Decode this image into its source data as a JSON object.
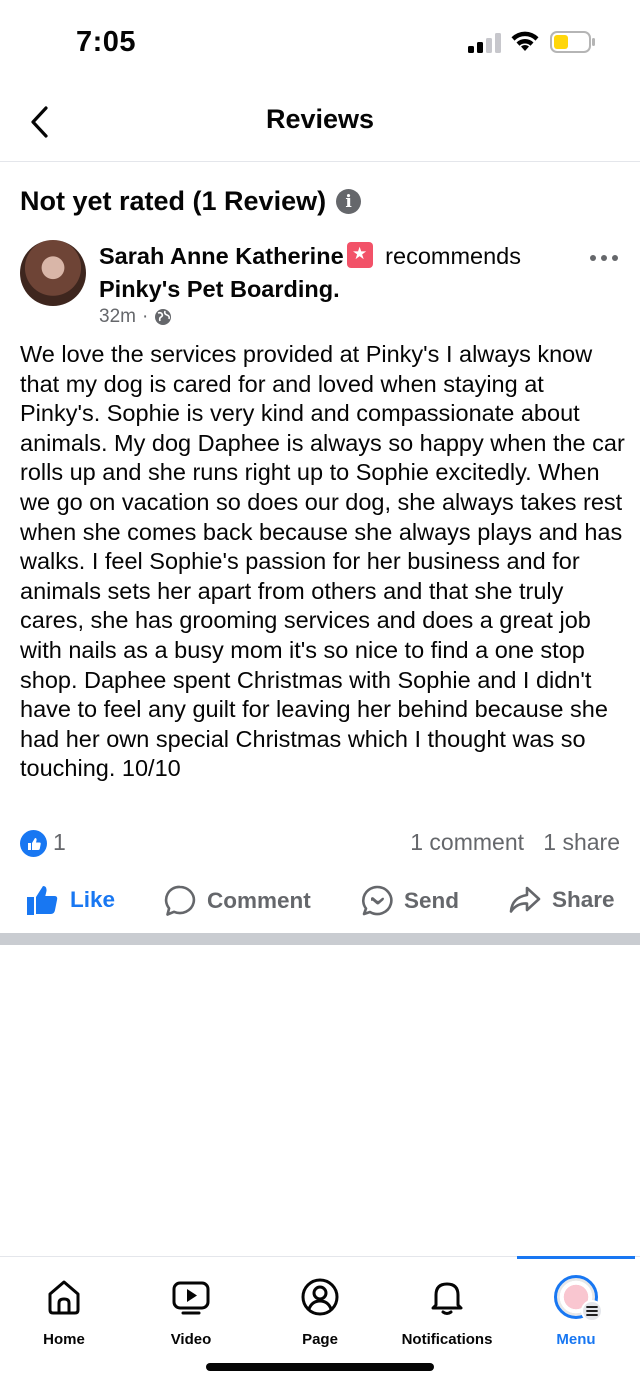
{
  "status_bar": {
    "time": "7:05"
  },
  "header": {
    "title": "Reviews"
  },
  "rating": {
    "heading": "Not yet rated (1 Review)"
  },
  "post": {
    "author": "Sarah Anne Katherine",
    "verb": "recommends",
    "page": "Pinky's Pet Boarding.",
    "time": "32m",
    "body": "We love the services provided at Pinky's I always know that my dog is cared for and loved when staying at Pinky's. Sophie is very kind and compassionate about animals. My dog Daphee is always so happy when the car rolls up and she runs right up to Sophie excitedly. When we go on vacation so does our dog, she always takes rest when she comes back because she always plays and has walks. I feel Sophie's passion for her business and for animals sets her apart from others and that she truly cares, she has grooming services and does a great job with nails as a busy mom it's so nice to find a one stop shop. Daphee spent Christmas with Sophie and I didn't have to feel any guilt for leaving her behind because she had her own special Christmas which I thought was so touching. 10/10",
    "reactions": "1",
    "comments": "1 comment",
    "shares": "1 share"
  },
  "actions": {
    "like": "Like",
    "comment": "Comment",
    "send": "Send",
    "share": "Share"
  },
  "nav": {
    "home": "Home",
    "video": "Video",
    "page": "Page",
    "notifications": "Notifications",
    "menu": "Menu"
  },
  "colors": {
    "accent": "#1877f2",
    "badge": "#f25268",
    "muted": "#65676b",
    "battery": "#ffd60a"
  }
}
